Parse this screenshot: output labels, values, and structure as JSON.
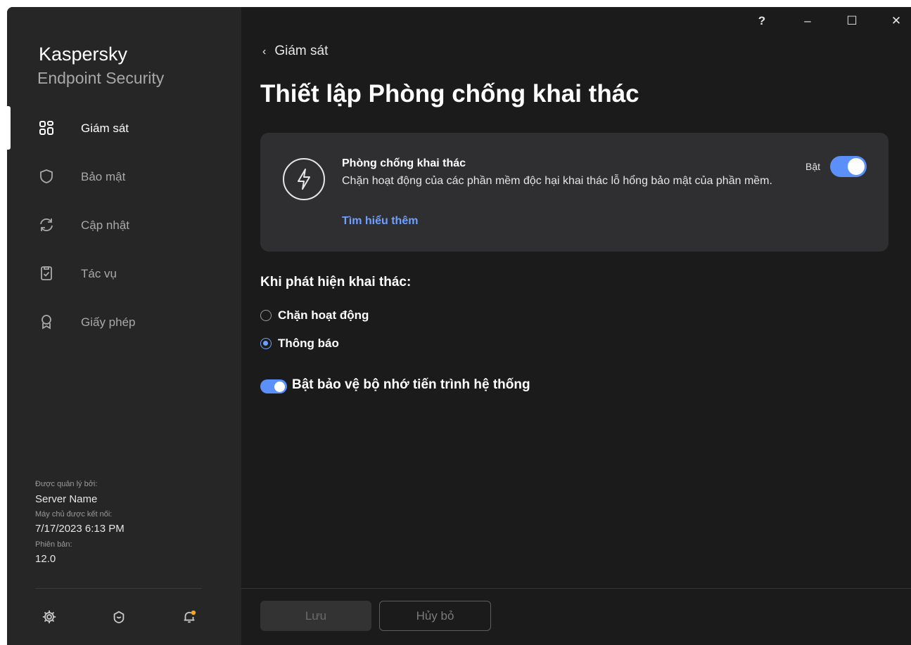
{
  "app": {
    "brand_line1": "Kaspersky",
    "brand_line2": "Endpoint Security"
  },
  "window_controls": {
    "help": "?",
    "minimize": "–",
    "maximize": "☐",
    "close": "✕"
  },
  "sidebar": {
    "items": [
      {
        "label": "Giám sát",
        "icon": "dashboard-icon",
        "active": true
      },
      {
        "label": "Bảo mật",
        "icon": "shield-icon",
        "active": false
      },
      {
        "label": "Cập nhật",
        "icon": "refresh-icon",
        "active": false
      },
      {
        "label": "Tác vụ",
        "icon": "clipboard-check-icon",
        "active": false
      },
      {
        "label": "Giấy phép",
        "icon": "license-ribbon-icon",
        "active": false
      }
    ],
    "meta": {
      "managed_by_label": "Được quản lý bởi:",
      "managed_by_value": "Server Name",
      "server_connected_label": "Máy chủ được kết nối:",
      "server_connected_value": "7/17/2023 6:13 PM",
      "version_label": "Phiên bản:",
      "version_value": "12.0"
    },
    "bottom_icons": [
      "settings-icon",
      "support-icon",
      "notifications-icon"
    ]
  },
  "main": {
    "back_label": "Giám sát",
    "page_title": "Thiết lập Phòng chống khai thác",
    "card": {
      "icon": "lightning-icon",
      "title": "Phòng chống khai thác",
      "description": "Chặn hoạt động của các phần mềm độc hại khai thác lỗ hổng bảo mật của phần mềm.",
      "link": "Tìm hiểu thêm",
      "toggle_label": "Bật",
      "toggle_on": true
    },
    "on_detect_heading": "Khi phát hiện khai thác:",
    "options": [
      {
        "label": "Chặn hoạt động",
        "checked": false
      },
      {
        "label": "Thông báo",
        "checked": true
      }
    ],
    "memory_protection_label": "Bật bảo vệ bộ nhớ tiến trình hệ thống",
    "memory_protection_on": true
  },
  "footer": {
    "save_label": "Lưu",
    "cancel_label": "Hủy bỏ"
  },
  "colors": {
    "accent": "#5b8ff9",
    "link": "#6fa0ff",
    "background": "#1b1b1b",
    "sidebar": "#262626",
    "card": "#2f2f31"
  }
}
